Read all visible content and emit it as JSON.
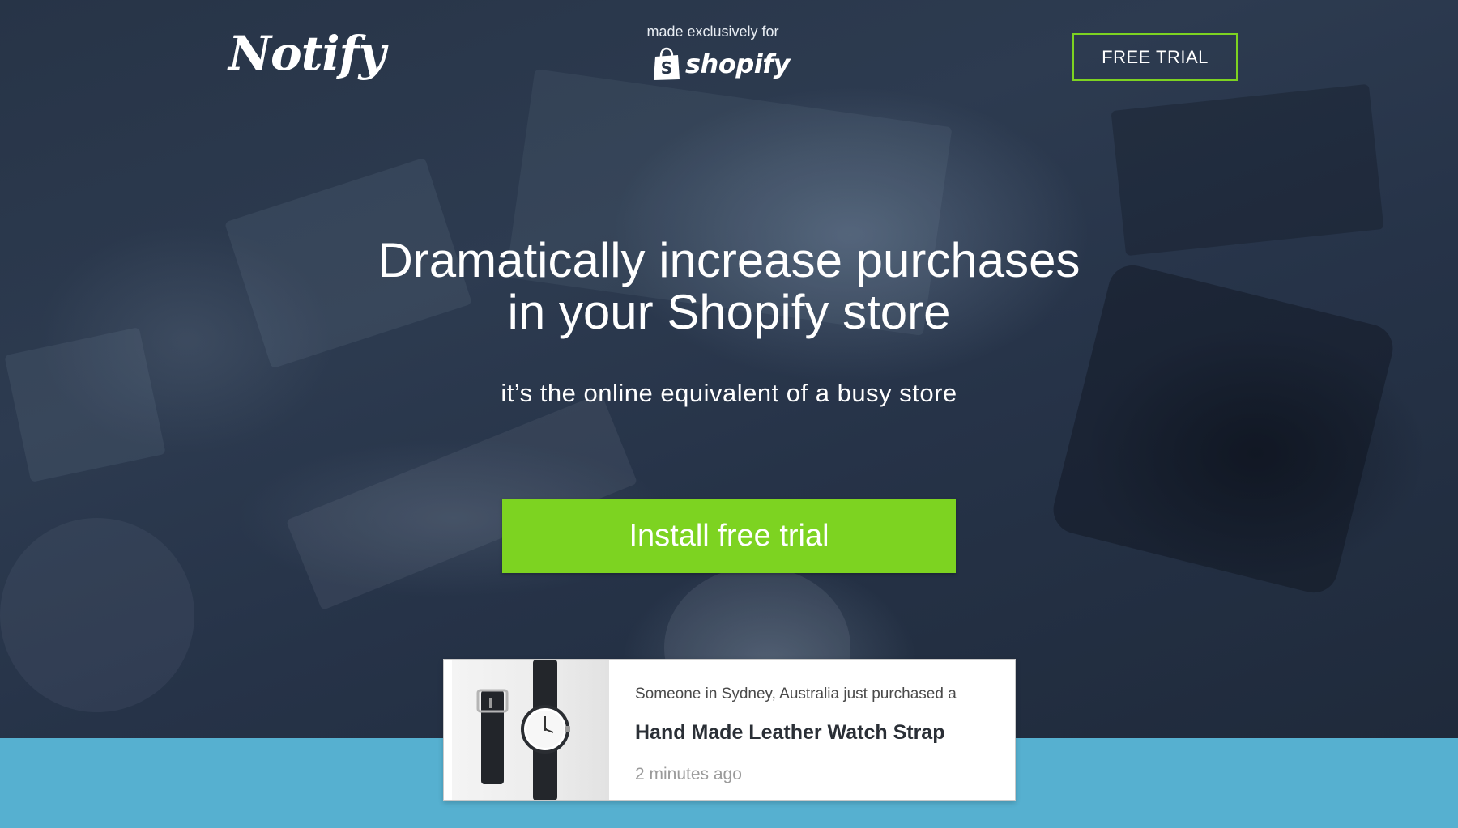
{
  "header": {
    "logo_text": "Notify",
    "made_for_text": "made exclusively for",
    "partner_brand": "shopify",
    "free_trial_label": "FREE TRIAL"
  },
  "hero": {
    "headline_line1": "Dramatically increase purchases",
    "headline_line2": "in your Shopify store",
    "subheadline": "it’s the online equivalent of a busy store",
    "install_button_label": "Install free trial"
  },
  "notification": {
    "message": "Someone in Sydney, Australia just purchased a",
    "product_name": "Hand Made Leather Watch Strap",
    "time_ago": "2 minutes ago",
    "image_icon": "watch-icon"
  },
  "colors": {
    "hero_overlay": "#273447",
    "accent_green": "#7dd321",
    "footer_blue": "#56b0d0",
    "card_background": "#ffffff"
  },
  "icons": {
    "shopify_bag": "shopify-bag-icon"
  }
}
